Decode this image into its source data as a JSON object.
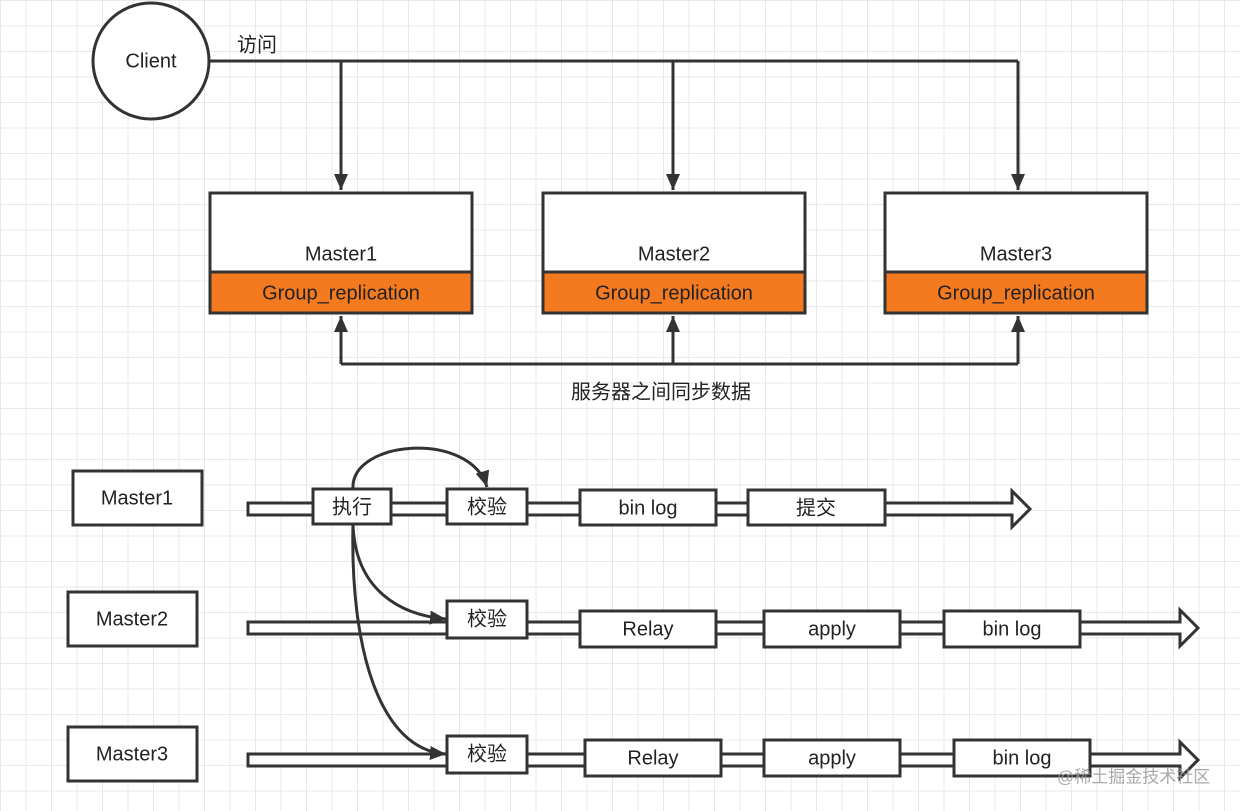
{
  "colors": {
    "accent": "#f47a20",
    "stroke": "#333333"
  },
  "top": {
    "client": "Client",
    "access_label": "访问",
    "servers": [
      {
        "name": "Master1",
        "module": "Group_replication"
      },
      {
        "name": "Master2",
        "module": "Group_replication"
      },
      {
        "name": "Master3",
        "module": "Group_replication"
      }
    ],
    "sync_label": "服务器之间同步数据"
  },
  "flow": {
    "rows": [
      {
        "label": "Master1",
        "steps": [
          "执行",
          "校验",
          "bin log",
          "提交"
        ]
      },
      {
        "label": "Master2",
        "steps": [
          "校验",
          "Relay",
          "apply",
          "bin log"
        ]
      },
      {
        "label": "Master3",
        "steps": [
          "校验",
          "Relay",
          "apply",
          "bin log"
        ]
      }
    ]
  },
  "watermark": "@稀土掘金技术社区"
}
